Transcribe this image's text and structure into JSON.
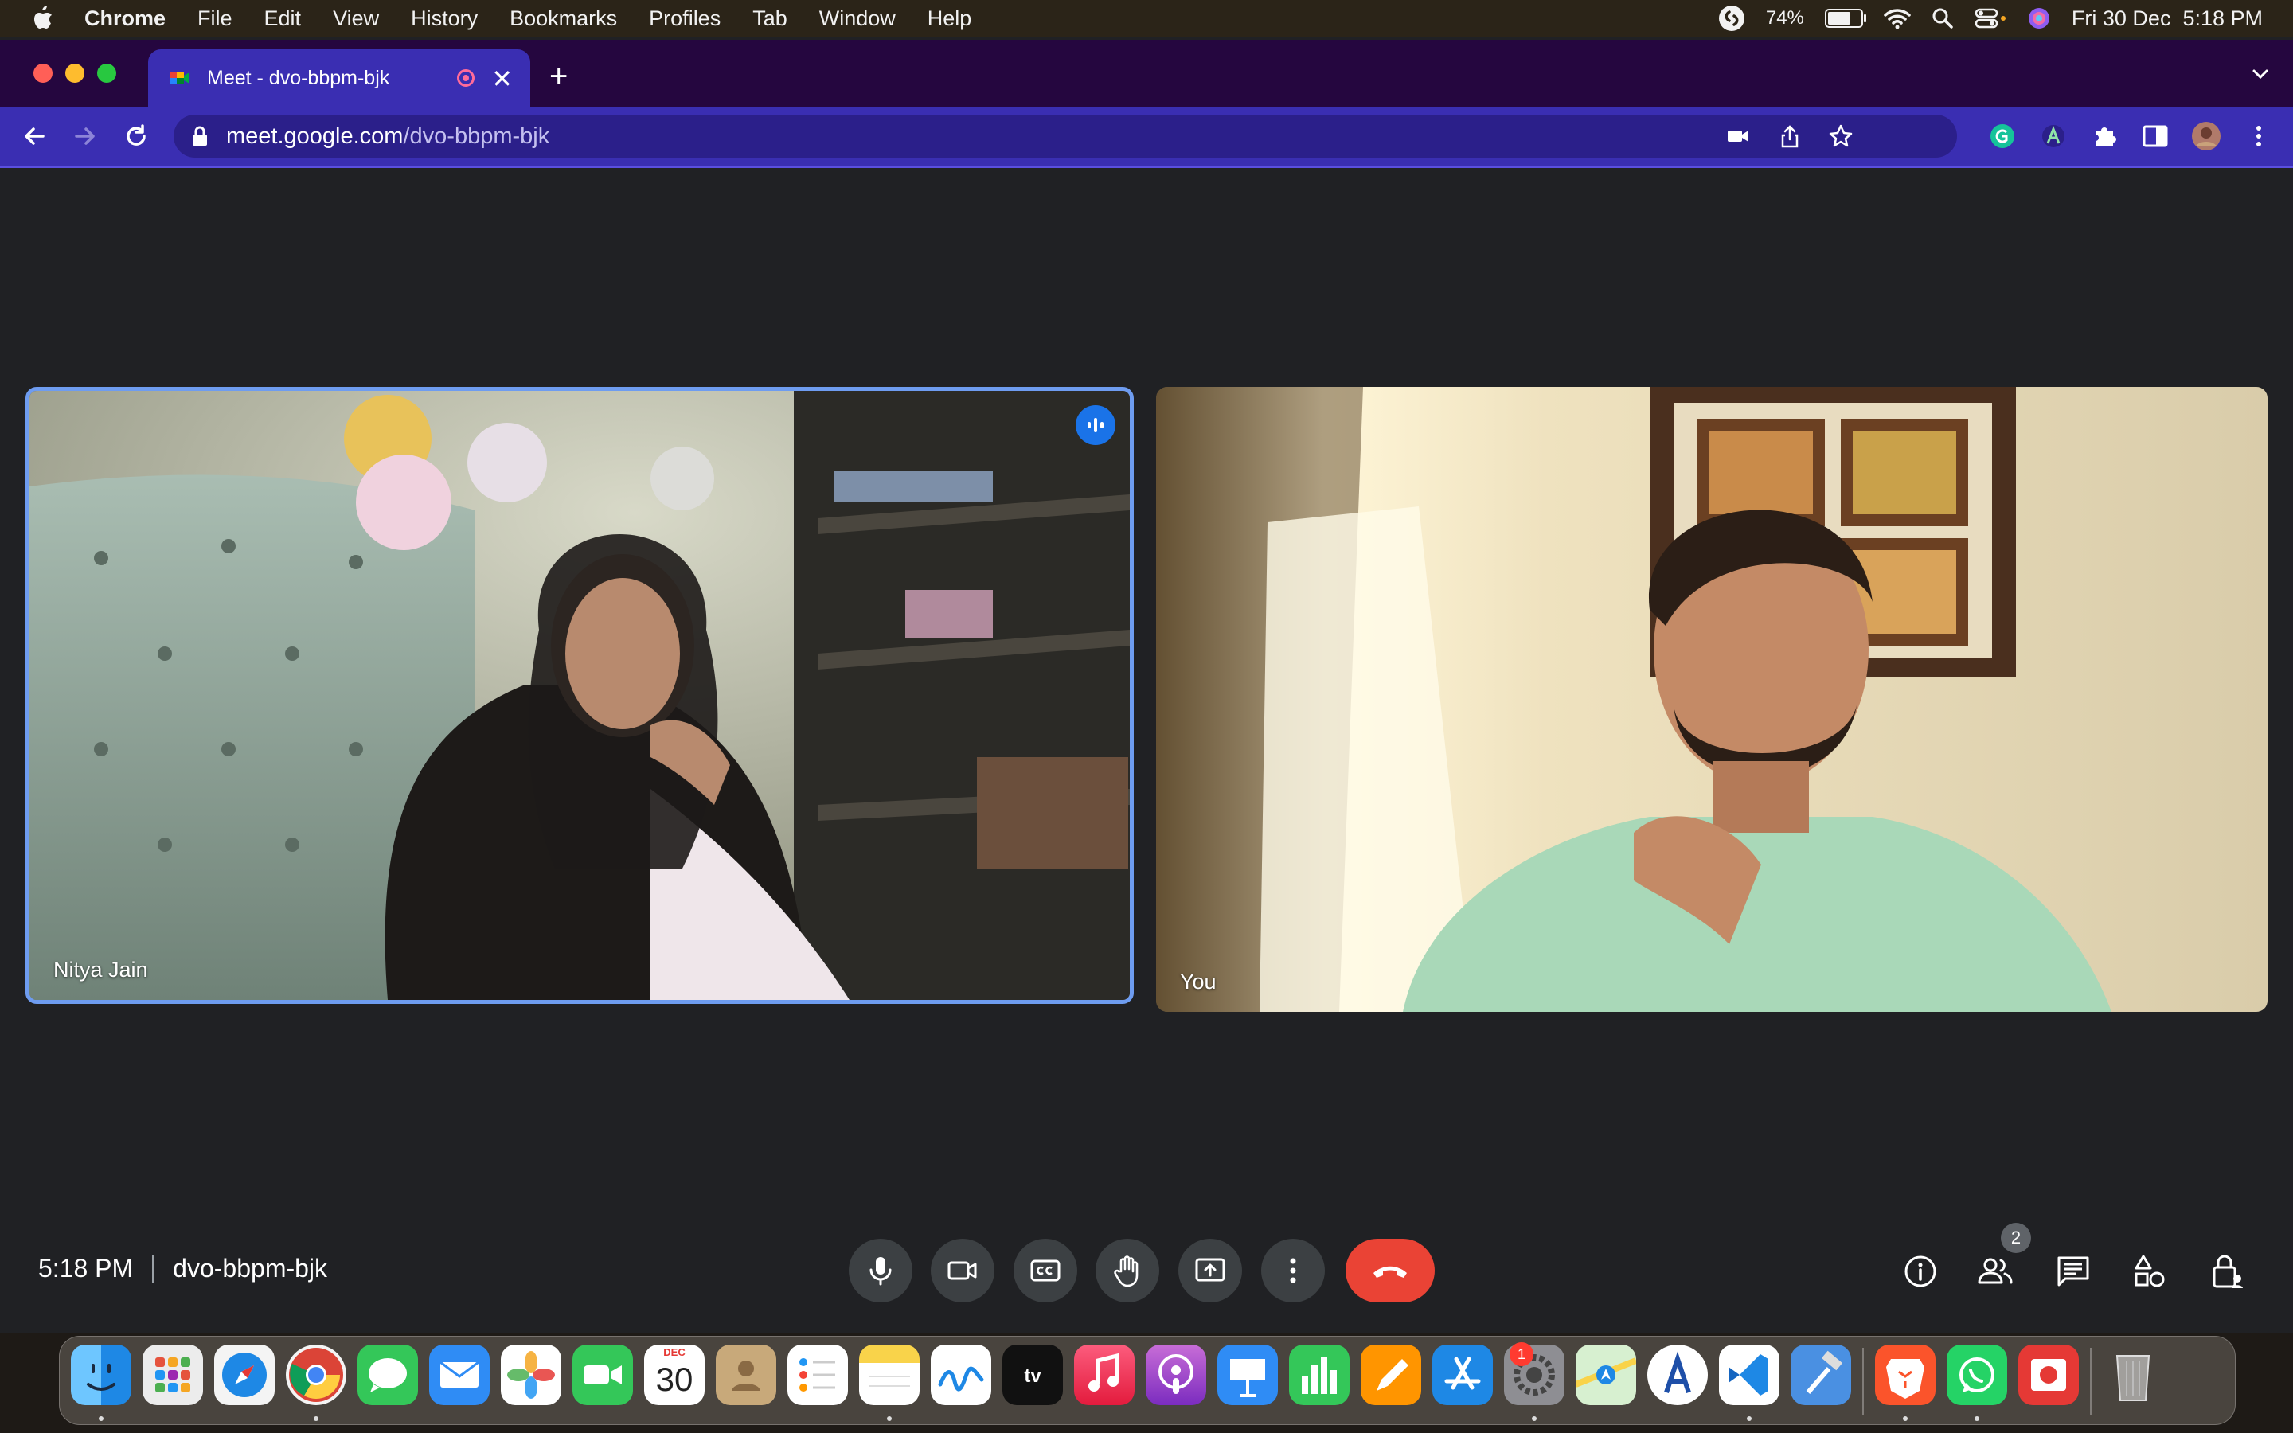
{
  "menubar": {
    "app_name": "Chrome",
    "menus": [
      "File",
      "Edit",
      "View",
      "History",
      "Bookmarks",
      "Profiles",
      "Tab",
      "Window",
      "Help"
    ],
    "battery": "74%",
    "battery_level": 0.74,
    "datetime": "Fri 30 Dec  5:18 PM",
    "status_icons": [
      "shazam-icon",
      "battery-icon",
      "wifi-icon",
      "spotlight-icon",
      "control-center-icon",
      "siri-icon"
    ]
  },
  "browser": {
    "tab_title": "Meet - dvo-bbpm-bjk",
    "url_host": "meet.google.com",
    "url_path": "/dvo-bbpm-bjk",
    "colors": {
      "tabstrip": "#25063f",
      "toolbar": "#3a2eb2"
    }
  },
  "meet": {
    "participants": [
      {
        "name": "Nitya Jain",
        "speaking": true
      },
      {
        "name": "You",
        "speaking": false
      }
    ],
    "clock": "5:18 PM",
    "meeting_code": "dvo-bbpm-bjk",
    "people_count": "2",
    "controls": [
      "microphone",
      "camera",
      "captions",
      "raise-hand",
      "present",
      "more-options",
      "leave-call"
    ],
    "right_controls": [
      "meeting-details",
      "people",
      "chat",
      "activities",
      "host-controls"
    ],
    "colors": {
      "end_call": "#ea4335",
      "control_bg": "#3c4043",
      "speaking_border": "#6e9cf0"
    }
  },
  "dock": {
    "apps": [
      "Finder",
      "Launchpad",
      "Safari",
      "Chrome",
      "Messages",
      "Mail",
      "Photos",
      "FaceTime",
      "Calendar",
      "Contacts",
      "Reminders",
      "Notes",
      "Freeform",
      "TV",
      "Music",
      "Podcasts",
      "Keynote",
      "Numbers",
      "Pages",
      "App Store",
      "System Settings",
      "Maps",
      "Xcode Instruments",
      "Visual Studio Code",
      "Xcode",
      "Brave",
      "WhatsApp",
      "Photo Booth",
      "Trash"
    ],
    "calendar_month": "DEC",
    "calendar_day": "30",
    "settings_badge": "1"
  }
}
